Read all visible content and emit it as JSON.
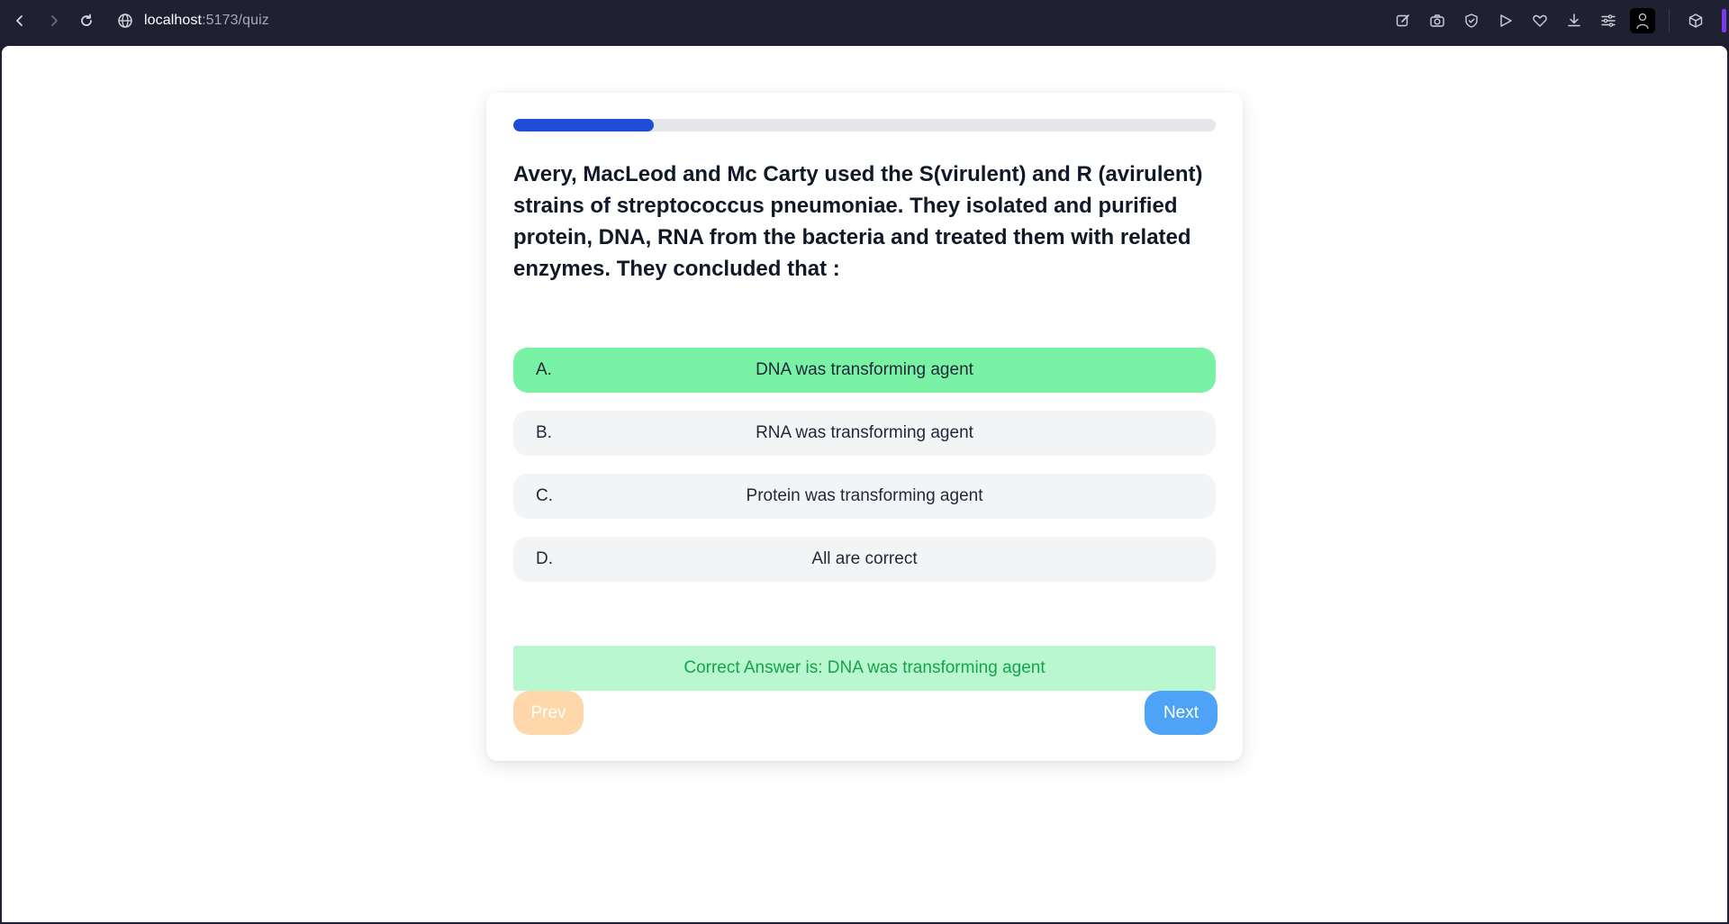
{
  "browser": {
    "url_host": "localhost",
    "url_path": ":5173/quiz"
  },
  "quiz": {
    "progress_fraction": 0.2,
    "question": "Avery, MacLeod and Mc Carty used the S(virulent) and R (avirulent) strains of streptococcus pneumoniae. They isolated and purified protein, DNA, RNA from the bacteria and treated them with related enzymes. They concluded that :",
    "options": [
      {
        "letter": "A.",
        "text": "DNA was transforming agent",
        "state": "correct"
      },
      {
        "letter": "B.",
        "text": "RNA was transforming agent",
        "state": "neutral"
      },
      {
        "letter": "C.",
        "text": "Protein was transforming agent",
        "state": "neutral"
      },
      {
        "letter": "D.",
        "text": "All are correct",
        "state": "neutral"
      }
    ],
    "answer_text": "Correct Answer is: DNA was transforming agent",
    "prev_label": "Prev",
    "next_label": "Next"
  },
  "colors": {
    "progress": "#1d4ed8",
    "correct_option": "#79f2a6",
    "answer_bg": "#b8f7cf",
    "answer_text": "#16a34a",
    "prev_btn": "#fed7aa",
    "next_btn": "#4ea3f7"
  }
}
